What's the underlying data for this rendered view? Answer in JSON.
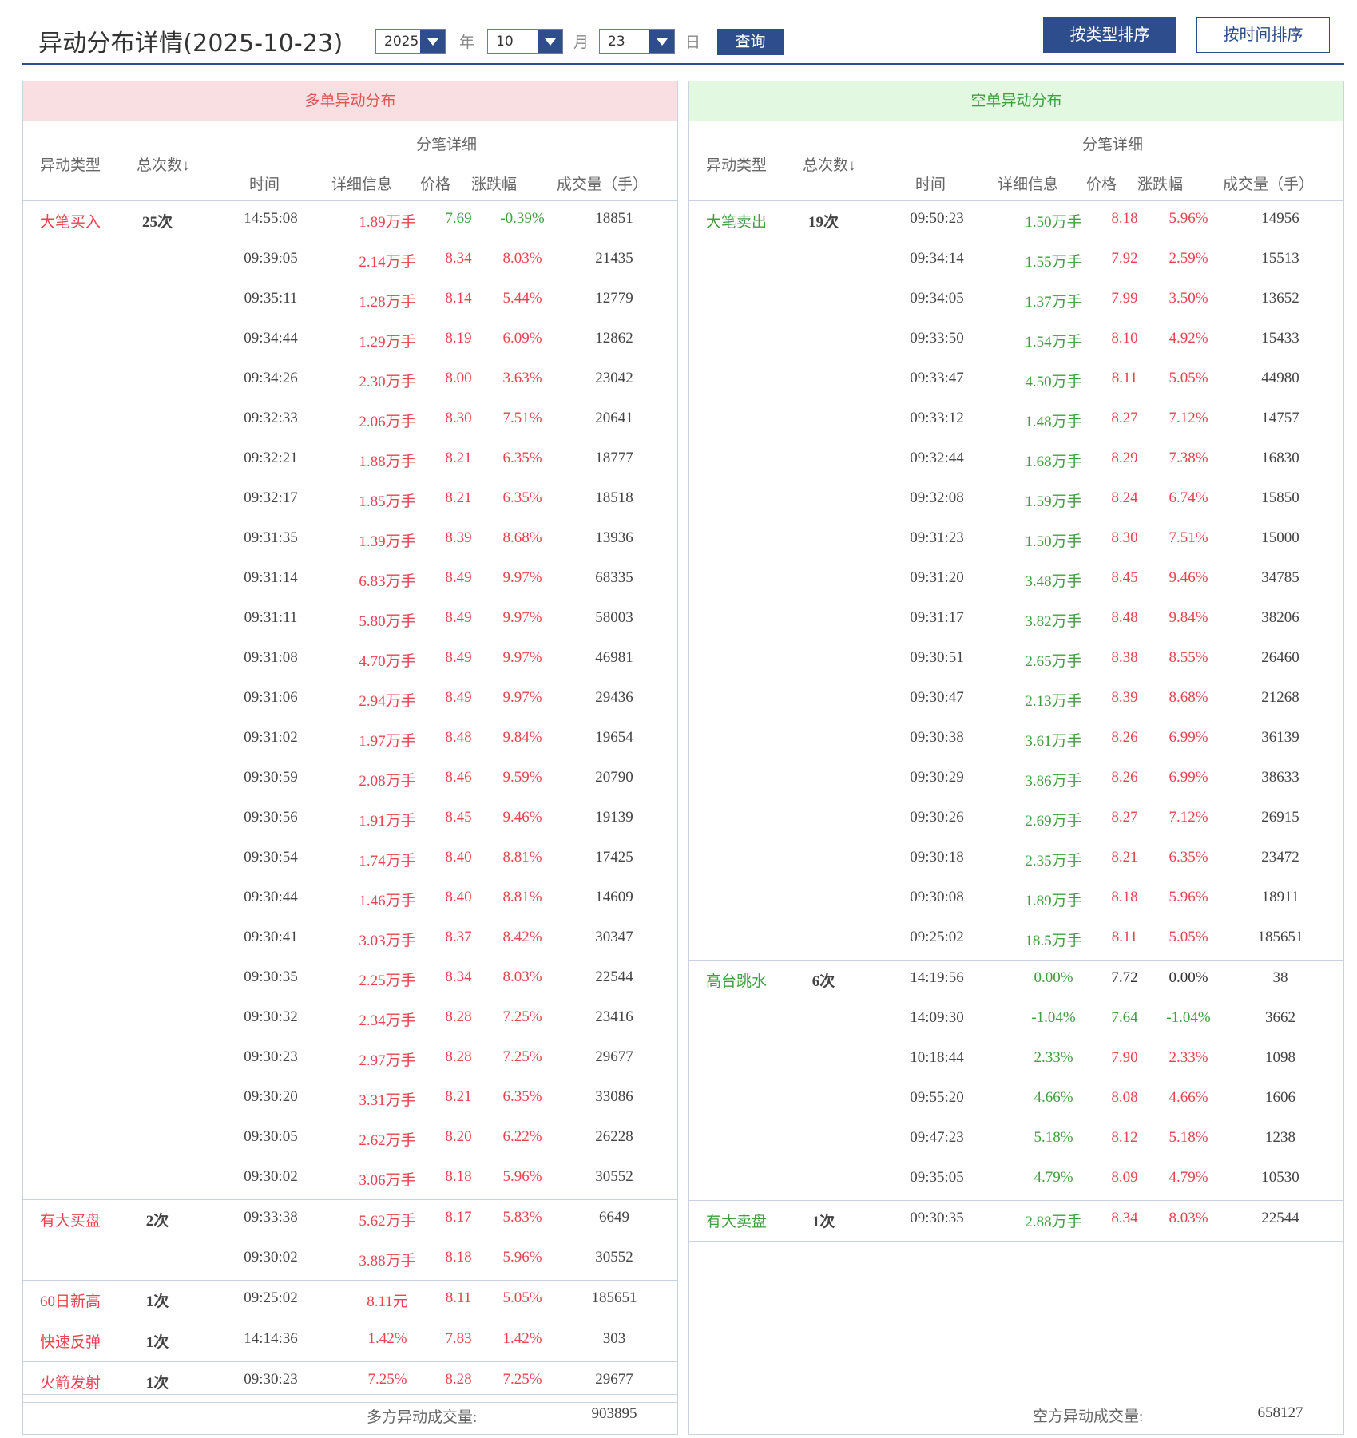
{
  "header": {
    "title": "异动分布详情(2025-10-23)",
    "year": "2025",
    "year_unit": "年",
    "month": "10",
    "month_unit": "月",
    "day": "23",
    "day_unit": "日",
    "query_label": "查询",
    "sort_by_type_label": "按类型排序",
    "sort_by_time_label": "按时间排序"
  },
  "columns": {
    "type": "异动类型",
    "count": "总次数↓",
    "detail": "分笔详细",
    "time": "时间",
    "info": "详细信息",
    "price": "价格",
    "change": "涨跌幅",
    "volume": "成交量（手）"
  },
  "long": {
    "title": "多单异动分布",
    "footer_label": "多方异动成交量:",
    "footer_value": "903895",
    "groups": [
      {
        "name": "大笔买入",
        "count": "25次",
        "rows": [
          {
            "time": "14:55:08",
            "info": "1.89万手",
            "price": "7.69",
            "change": "-0.39%",
            "volume": "18851",
            "info_c": "red",
            "price_c": "green",
            "chg_c": "green"
          },
          {
            "time": "09:39:05",
            "info": "2.14万手",
            "price": "8.34",
            "change": "8.03%",
            "volume": "21435",
            "info_c": "red",
            "price_c": "red",
            "chg_c": "red"
          },
          {
            "time": "09:35:11",
            "info": "1.28万手",
            "price": "8.14",
            "change": "5.44%",
            "volume": "12779",
            "info_c": "red",
            "price_c": "red",
            "chg_c": "red"
          },
          {
            "time": "09:34:44",
            "info": "1.29万手",
            "price": "8.19",
            "change": "6.09%",
            "volume": "12862",
            "info_c": "red",
            "price_c": "red",
            "chg_c": "red"
          },
          {
            "time": "09:34:26",
            "info": "2.30万手",
            "price": "8.00",
            "change": "3.63%",
            "volume": "23042",
            "info_c": "red",
            "price_c": "red",
            "chg_c": "red"
          },
          {
            "time": "09:32:33",
            "info": "2.06万手",
            "price": "8.30",
            "change": "7.51%",
            "volume": "20641",
            "info_c": "red",
            "price_c": "red",
            "chg_c": "red"
          },
          {
            "time": "09:32:21",
            "info": "1.88万手",
            "price": "8.21",
            "change": "6.35%",
            "volume": "18777",
            "info_c": "red",
            "price_c": "red",
            "chg_c": "red"
          },
          {
            "time": "09:32:17",
            "info": "1.85万手",
            "price": "8.21",
            "change": "6.35%",
            "volume": "18518",
            "info_c": "red",
            "price_c": "red",
            "chg_c": "red"
          },
          {
            "time": "09:31:35",
            "info": "1.39万手",
            "price": "8.39",
            "change": "8.68%",
            "volume": "13936",
            "info_c": "red",
            "price_c": "red",
            "chg_c": "red"
          },
          {
            "time": "09:31:14",
            "info": "6.83万手",
            "price": "8.49",
            "change": "9.97%",
            "volume": "68335",
            "info_c": "red",
            "price_c": "red",
            "chg_c": "red"
          },
          {
            "time": "09:31:11",
            "info": "5.80万手",
            "price": "8.49",
            "change": "9.97%",
            "volume": "58003",
            "info_c": "red",
            "price_c": "red",
            "chg_c": "red"
          },
          {
            "time": "09:31:08",
            "info": "4.70万手",
            "price": "8.49",
            "change": "9.97%",
            "volume": "46981",
            "info_c": "red",
            "price_c": "red",
            "chg_c": "red"
          },
          {
            "time": "09:31:06",
            "info": "2.94万手",
            "price": "8.49",
            "change": "9.97%",
            "volume": "29436",
            "info_c": "red",
            "price_c": "red",
            "chg_c": "red"
          },
          {
            "time": "09:31:02",
            "info": "1.97万手",
            "price": "8.48",
            "change": "9.84%",
            "volume": "19654",
            "info_c": "red",
            "price_c": "red",
            "chg_c": "red"
          },
          {
            "time": "09:30:59",
            "info": "2.08万手",
            "price": "8.46",
            "change": "9.59%",
            "volume": "20790",
            "info_c": "red",
            "price_c": "red",
            "chg_c": "red"
          },
          {
            "time": "09:30:56",
            "info": "1.91万手",
            "price": "8.45",
            "change": "9.46%",
            "volume": "19139",
            "info_c": "red",
            "price_c": "red",
            "chg_c": "red"
          },
          {
            "time": "09:30:54",
            "info": "1.74万手",
            "price": "8.40",
            "change": "8.81%",
            "volume": "17425",
            "info_c": "red",
            "price_c": "red",
            "chg_c": "red"
          },
          {
            "time": "09:30:44",
            "info": "1.46万手",
            "price": "8.40",
            "change": "8.81%",
            "volume": "14609",
            "info_c": "red",
            "price_c": "red",
            "chg_c": "red"
          },
          {
            "time": "09:30:41",
            "info": "3.03万手",
            "price": "8.37",
            "change": "8.42%",
            "volume": "30347",
            "info_c": "red",
            "price_c": "red",
            "chg_c": "red"
          },
          {
            "time": "09:30:35",
            "info": "2.25万手",
            "price": "8.34",
            "change": "8.03%",
            "volume": "22544",
            "info_c": "red",
            "price_c": "red",
            "chg_c": "red"
          },
          {
            "time": "09:30:32",
            "info": "2.34万手",
            "price": "8.28",
            "change": "7.25%",
            "volume": "23416",
            "info_c": "red",
            "price_c": "red",
            "chg_c": "red"
          },
          {
            "time": "09:30:23",
            "info": "2.97万手",
            "price": "8.28",
            "change": "7.25%",
            "volume": "29677",
            "info_c": "red",
            "price_c": "red",
            "chg_c": "red"
          },
          {
            "time": "09:30:20",
            "info": "3.31万手",
            "price": "8.21",
            "change": "6.35%",
            "volume": "33086",
            "info_c": "red",
            "price_c": "red",
            "chg_c": "red"
          },
          {
            "time": "09:30:05",
            "info": "2.62万手",
            "price": "8.20",
            "change": "6.22%",
            "volume": "26228",
            "info_c": "red",
            "price_c": "red",
            "chg_c": "red"
          },
          {
            "time": "09:30:02",
            "info": "3.06万手",
            "price": "8.18",
            "change": "5.96%",
            "volume": "30552",
            "info_c": "red",
            "price_c": "red",
            "chg_c": "red"
          }
        ]
      },
      {
        "name": "有大买盘",
        "count": "2次",
        "rows": [
          {
            "time": "09:33:38",
            "info": "5.62万手",
            "price": "8.17",
            "change": "5.83%",
            "volume": "6649",
            "info_c": "red",
            "price_c": "red",
            "chg_c": "red"
          },
          {
            "time": "09:30:02",
            "info": "3.88万手",
            "price": "8.18",
            "change": "5.96%",
            "volume": "30552",
            "info_c": "red",
            "price_c": "red",
            "chg_c": "red"
          }
        ]
      },
      {
        "name": "60日新高",
        "count": "1次",
        "rows": [
          {
            "time": "09:25:02",
            "info": "8.11元",
            "price": "8.11",
            "change": "5.05%",
            "volume": "185651",
            "info_c": "red",
            "price_c": "red",
            "chg_c": "red"
          }
        ]
      },
      {
        "name": "快速反弹",
        "count": "1次",
        "rows": [
          {
            "time": "14:14:36",
            "info": "1.42%",
            "price": "7.83",
            "change": "1.42%",
            "volume": "303",
            "info_c": "red",
            "price_c": "red",
            "chg_c": "red"
          }
        ]
      },
      {
        "name": "火箭发射",
        "count": "1次",
        "rows": [
          {
            "time": "09:30:23",
            "info": "7.25%",
            "price": "8.28",
            "change": "7.25%",
            "volume": "29677",
            "info_c": "red",
            "price_c": "red",
            "chg_c": "red"
          }
        ]
      }
    ]
  },
  "short": {
    "title": "空单异动分布",
    "footer_label": "空方异动成交量:",
    "footer_value": "658127",
    "groups": [
      {
        "name": "大笔卖出",
        "count": "19次",
        "rows": [
          {
            "time": "09:50:23",
            "info": "1.50万手",
            "price": "8.18",
            "change": "5.96%",
            "volume": "14956",
            "info_c": "green",
            "price_c": "red",
            "chg_c": "red"
          },
          {
            "time": "09:34:14",
            "info": "1.55万手",
            "price": "7.92",
            "change": "2.59%",
            "volume": "15513",
            "info_c": "green",
            "price_c": "red",
            "chg_c": "red"
          },
          {
            "time": "09:34:05",
            "info": "1.37万手",
            "price": "7.99",
            "change": "3.50%",
            "volume": "13652",
            "info_c": "green",
            "price_c": "red",
            "chg_c": "red"
          },
          {
            "time": "09:33:50",
            "info": "1.54万手",
            "price": "8.10",
            "change": "4.92%",
            "volume": "15433",
            "info_c": "green",
            "price_c": "red",
            "chg_c": "red"
          },
          {
            "time": "09:33:47",
            "info": "4.50万手",
            "price": "8.11",
            "change": "5.05%",
            "volume": "44980",
            "info_c": "green",
            "price_c": "red",
            "chg_c": "red"
          },
          {
            "time": "09:33:12",
            "info": "1.48万手",
            "price": "8.27",
            "change": "7.12%",
            "volume": "14757",
            "info_c": "green",
            "price_c": "red",
            "chg_c": "red"
          },
          {
            "time": "09:32:44",
            "info": "1.68万手",
            "price": "8.29",
            "change": "7.38%",
            "volume": "16830",
            "info_c": "green",
            "price_c": "red",
            "chg_c": "red"
          },
          {
            "time": "09:32:08",
            "info": "1.59万手",
            "price": "8.24",
            "change": "6.74%",
            "volume": "15850",
            "info_c": "green",
            "price_c": "red",
            "chg_c": "red"
          },
          {
            "time": "09:31:23",
            "info": "1.50万手",
            "price": "8.30",
            "change": "7.51%",
            "volume": "15000",
            "info_c": "green",
            "price_c": "red",
            "chg_c": "red"
          },
          {
            "time": "09:31:20",
            "info": "3.48万手",
            "price": "8.45",
            "change": "9.46%",
            "volume": "34785",
            "info_c": "green",
            "price_c": "red",
            "chg_c": "red"
          },
          {
            "time": "09:31:17",
            "info": "3.82万手",
            "price": "8.48",
            "change": "9.84%",
            "volume": "38206",
            "info_c": "green",
            "price_c": "red",
            "chg_c": "red"
          },
          {
            "time": "09:30:51",
            "info": "2.65万手",
            "price": "8.38",
            "change": "8.55%",
            "volume": "26460",
            "info_c": "green",
            "price_c": "red",
            "chg_c": "red"
          },
          {
            "time": "09:30:47",
            "info": "2.13万手",
            "price": "8.39",
            "change": "8.68%",
            "volume": "21268",
            "info_c": "green",
            "price_c": "red",
            "chg_c": "red"
          },
          {
            "time": "09:30:38",
            "info": "3.61万手",
            "price": "8.26",
            "change": "6.99%",
            "volume": "36139",
            "info_c": "green",
            "price_c": "red",
            "chg_c": "red"
          },
          {
            "time": "09:30:29",
            "info": "3.86万手",
            "price": "8.26",
            "change": "6.99%",
            "volume": "38633",
            "info_c": "green",
            "price_c": "red",
            "chg_c": "red"
          },
          {
            "time": "09:30:26",
            "info": "2.69万手",
            "price": "8.27",
            "change": "7.12%",
            "volume": "26915",
            "info_c": "green",
            "price_c": "red",
            "chg_c": "red"
          },
          {
            "time": "09:30:18",
            "info": "2.35万手",
            "price": "8.21",
            "change": "6.35%",
            "volume": "23472",
            "info_c": "green",
            "price_c": "red",
            "chg_c": "red"
          },
          {
            "time": "09:30:08",
            "info": "1.89万手",
            "price": "8.18",
            "change": "5.96%",
            "volume": "18911",
            "info_c": "green",
            "price_c": "red",
            "chg_c": "red"
          },
          {
            "time": "09:25:02",
            "info": "18.5万手",
            "price": "8.11",
            "change": "5.05%",
            "volume": "185651",
            "info_c": "green",
            "price_c": "red",
            "chg_c": "red"
          }
        ]
      },
      {
        "name": "高台跳水",
        "count": "6次",
        "rows": [
          {
            "time": "14:19:56",
            "info": "0.00%",
            "price": "7.72",
            "change": "0.00%",
            "volume": "38",
            "info_c": "green",
            "price_c": "neutral",
            "chg_c": "neutral"
          },
          {
            "time": "14:09:30",
            "info": "-1.04%",
            "price": "7.64",
            "change": "-1.04%",
            "volume": "3662",
            "info_c": "green",
            "price_c": "green",
            "chg_c": "green"
          },
          {
            "time": "10:18:44",
            "info": "2.33%",
            "price": "7.90",
            "change": "2.33%",
            "volume": "1098",
            "info_c": "green",
            "price_c": "red",
            "chg_c": "red"
          },
          {
            "time": "09:55:20",
            "info": "4.66%",
            "price": "8.08",
            "change": "4.66%",
            "volume": "1606",
            "info_c": "green",
            "price_c": "red",
            "chg_c": "red"
          },
          {
            "time": "09:47:23",
            "info": "5.18%",
            "price": "8.12",
            "change": "5.18%",
            "volume": "1238",
            "info_c": "green",
            "price_c": "red",
            "chg_c": "red"
          },
          {
            "time": "09:35:05",
            "info": "4.79%",
            "price": "8.09",
            "change": "4.79%",
            "volume": "10530",
            "info_c": "green",
            "price_c": "red",
            "chg_c": "red"
          }
        ]
      },
      {
        "name": "有大卖盘",
        "count": "1次",
        "rows": [
          {
            "time": "09:30:35",
            "info": "2.88万手",
            "price": "8.34",
            "change": "8.03%",
            "volume": "22544",
            "info_c": "green",
            "price_c": "red",
            "chg_c": "red"
          }
        ]
      }
    ]
  },
  "colors": {
    "brand": "#2e4d8c",
    "up": "#e8434e",
    "down": "#3f9e3f",
    "long_header_bg": "#f9dfe1",
    "short_header_bg": "#e3f8e1"
  }
}
